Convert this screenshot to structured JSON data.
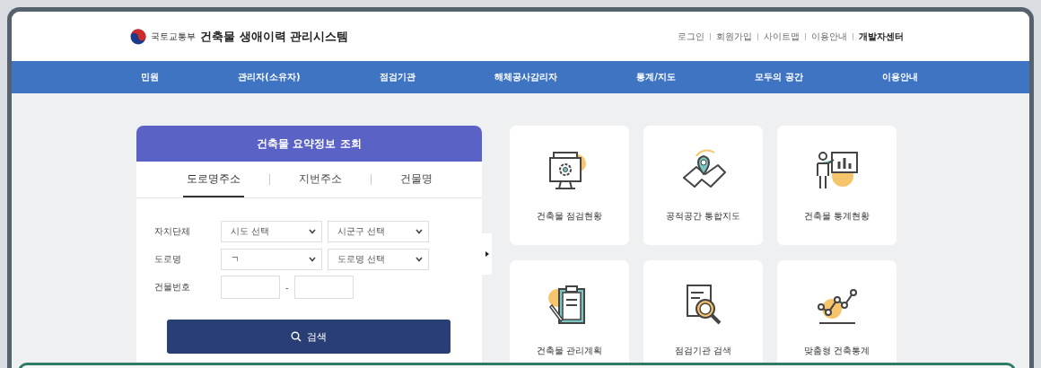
{
  "header": {
    "ministry": "국토교통부",
    "title": "건축물 생애이력 관리시스템",
    "links": [
      "로그인",
      "회원가입",
      "사이트맵",
      "이용안내",
      "개발자센터"
    ]
  },
  "nav": [
    "민원",
    "관리자(소유자)",
    "점검기관",
    "해체공사감리자",
    "통계/지도",
    "모두의 공간",
    "이용안내"
  ],
  "search_panel": {
    "title": "건축물 요약정보 조회",
    "tabs": [
      {
        "label": "도로명주소",
        "selected": true
      },
      {
        "label": "지번주소",
        "selected": false
      },
      {
        "label": "건물명",
        "selected": false
      }
    ],
    "rows": [
      {
        "label": "자치단체",
        "kind": "selects",
        "fields": [
          "시도 선택",
          "시군구 선택"
        ]
      },
      {
        "label": "도로명",
        "kind": "selects",
        "fields": [
          "ㄱ",
          "도로명 선택"
        ]
      },
      {
        "label": "건물번호",
        "kind": "inputs",
        "separator": "-"
      }
    ],
    "button": "검색"
  },
  "tiles": [
    {
      "kind": "monitor-gear",
      "label": "건축물 점검현황"
    },
    {
      "kind": "map-pin",
      "label": "공적공간 통합지도"
    },
    {
      "kind": "presenter-chart",
      "label": "건축물 통계현황"
    },
    {
      "kind": "clipboard",
      "label": "건축물 관리계획"
    },
    {
      "kind": "document-search",
      "label": "점검기관 검색"
    },
    {
      "kind": "line-chart",
      "label": "맞춤형 건축통계"
    }
  ]
}
